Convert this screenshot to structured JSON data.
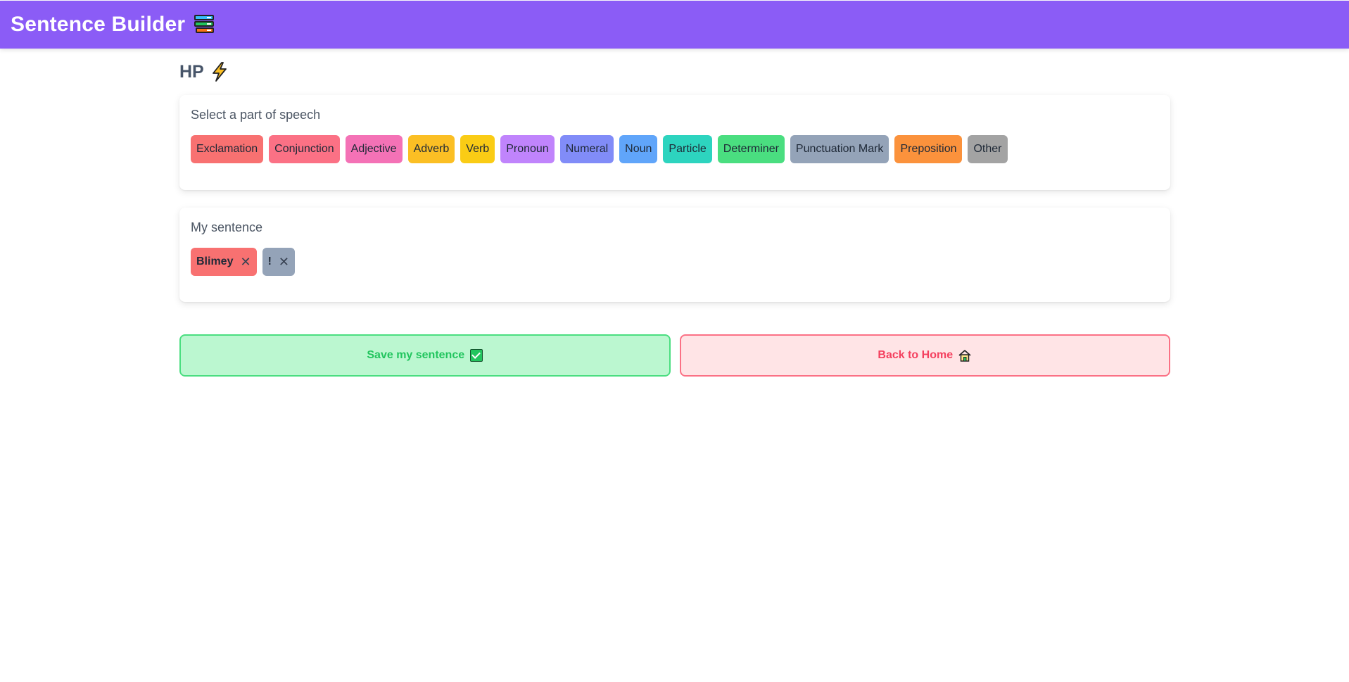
{
  "header": {
    "title": "Sentence Builder",
    "icon": "books-icon"
  },
  "hp": {
    "label": "HP",
    "icon": "lightning-icon"
  },
  "speech_panel": {
    "label": "Select a part of speech",
    "parts": [
      {
        "label": "Exclamation",
        "color": "#f87171"
      },
      {
        "label": "Conjunction",
        "color": "#fb7185"
      },
      {
        "label": "Adjective",
        "color": "#f472b6"
      },
      {
        "label": "Adverb",
        "color": "#fbbf24"
      },
      {
        "label": "Verb",
        "color": "#facc15"
      },
      {
        "label": "Pronoun",
        "color": "#c084fc"
      },
      {
        "label": "Numeral",
        "color": "#818cf8"
      },
      {
        "label": "Noun",
        "color": "#60a5fa"
      },
      {
        "label": "Particle",
        "color": "#2dd4bf"
      },
      {
        "label": "Determiner",
        "color": "#4ade80"
      },
      {
        "label": "Punctuation Mark",
        "color": "#94a3b8"
      },
      {
        "label": "Preposition",
        "color": "#fb923c"
      },
      {
        "label": "Other",
        "color": "#a3a3a3"
      }
    ]
  },
  "sentence_panel": {
    "label": "My sentence",
    "words": [
      {
        "label": "Blimey",
        "color": "#f87171"
      },
      {
        "label": "!",
        "color": "#94a3b8"
      }
    ],
    "remove_glyph": "✕"
  },
  "actions": {
    "save_label": "Save my sentence",
    "home_label": "Back to Home"
  }
}
